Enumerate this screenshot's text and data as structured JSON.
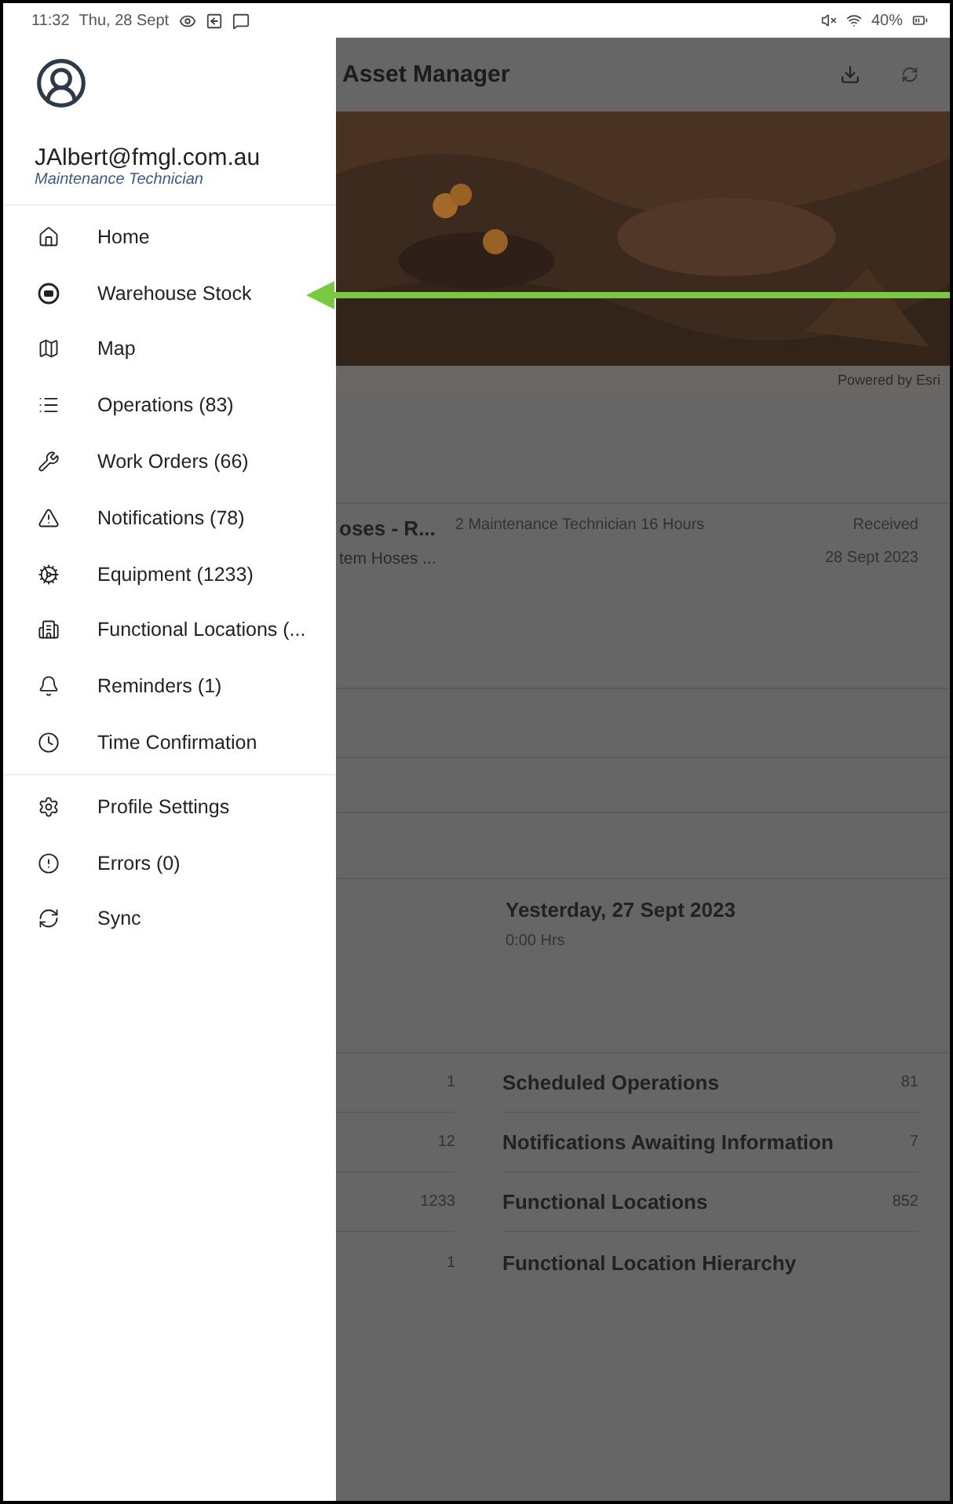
{
  "status_bar": {
    "time": "11:32",
    "date": "Thu, 28 Sept",
    "battery": "40%"
  },
  "app": {
    "title": "Asset Manager",
    "map_credit": "Powered by Esri",
    "work_order": {
      "title": "oses - R...",
      "subtitle": "tem Hoses ...",
      "detail": "2 Maintenance Technician 16 Hours",
      "status": "Received",
      "date": "28 Sept 2023"
    },
    "time_summary": {
      "date": "Yesterday, 27 Sept 2023",
      "hours": "0:00 Hrs"
    },
    "left_counts": [
      "1",
      "12",
      "1233",
      "1"
    ],
    "overview": [
      {
        "label": "Scheduled Operations",
        "count": "81"
      },
      {
        "label": "Notifications Awaiting Information",
        "count": "7"
      },
      {
        "label": "Functional Locations",
        "count": "852"
      },
      {
        "label": "Functional Location Hierarchy"
      }
    ]
  },
  "drawer": {
    "email": "JAlbert@fmgl.com.au",
    "role": "Maintenance Technician",
    "sections": [
      [
        "Home",
        "Warehouse Stock",
        "Map",
        "Operations (83)",
        "Work Orders (66)",
        "Notifications (78)",
        "Equipment (1233)",
        "Functional Locations (...",
        "Reminders (1)",
        "Time Confirmation"
      ],
      [
        "Profile Settings",
        "Errors (0)",
        "Sync"
      ]
    ]
  }
}
